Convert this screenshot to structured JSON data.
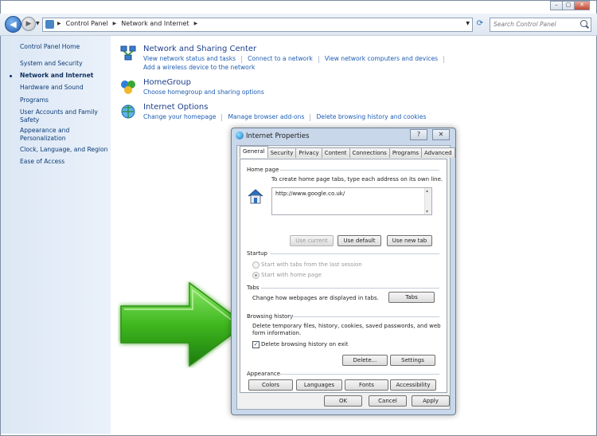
{
  "window": {
    "caption_buttons": [
      "–",
      "▢",
      "✕"
    ]
  },
  "toolbar": {
    "back_glyph": "◀",
    "forward_glyph": "▶",
    "breadcrumbs": [
      "Control Panel",
      "Network and Internet"
    ],
    "search_placeholder": "Search Control Panel"
  },
  "sidebar": {
    "home": "Control Panel Home",
    "items": [
      "System and Security",
      "Network and Internet",
      "Hardware and Sound",
      "Programs",
      "User Accounts and Family",
      "Safety",
      "Appearance and",
      "Personalization",
      "Clock, Language, and Region",
      "Ease of Access"
    ],
    "active": "Network and Internet"
  },
  "categories": [
    {
      "title": "Network and Sharing Center",
      "icon": "network-icon",
      "links": [
        "View network status and tasks",
        "Connect to a network",
        "View network computers and devices"
      ],
      "links2": [
        "Add a wireless device to the network"
      ]
    },
    {
      "title": "HomeGroup",
      "icon": "homegroup-icon",
      "links": [
        "Choose homegroup and sharing options"
      ]
    },
    {
      "title": "Internet Options",
      "icon": "internet-options-icon",
      "links": [
        "Change your homepage",
        "Manage browser add-ons",
        "Delete browsing history and cookies"
      ]
    }
  ],
  "dialog": {
    "title": "Internet Properties",
    "help_glyph": "?",
    "close_glyph": "✕",
    "tabs": [
      "General",
      "Security",
      "Privacy",
      "Content",
      "Connections",
      "Programs",
      "Advanced"
    ],
    "active_tab": "General",
    "home_page": {
      "label": "Home page",
      "hint": "To create home page tabs, type each address on its own line.",
      "url": "http://www.google.co.uk/",
      "buttons": [
        "Use current",
        "Use default",
        "Use new tab"
      ]
    },
    "startup": {
      "label": "Startup",
      "options": [
        "Start with tabs from the last session",
        "Start with home page"
      ],
      "selected": "Start with home page"
    },
    "tabs_group": {
      "label": "Tabs",
      "text": "Change how webpages are displayed in tabs.",
      "button": "Tabs"
    },
    "browsing_history": {
      "label": "Browsing history",
      "text1": "Delete temporary files, history, cookies, saved passwords, and web",
      "text2": "form information.",
      "checkbox": "Delete browsing history on exit",
      "checked": true,
      "buttons": [
        "Delete...",
        "Settings"
      ]
    },
    "appearance": {
      "label": "Appearance",
      "buttons": [
        "Colors",
        "Languages",
        "Fonts",
        "Accessibility"
      ]
    },
    "footer": [
      "OK",
      "Cancel",
      "Apply"
    ]
  },
  "colors": {
    "arrow_green": "#3fb81f",
    "link_blue": "#1e5db3",
    "sidebar_bg": "#dce7f5"
  }
}
